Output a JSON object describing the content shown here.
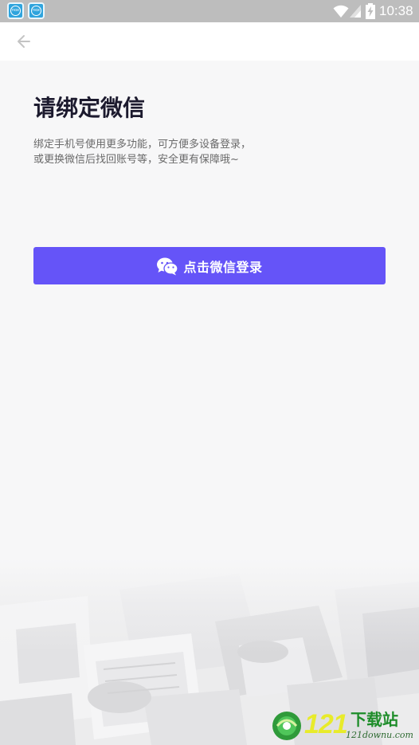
{
  "status_bar": {
    "time": "10:38",
    "notification_icons": [
      "nox-app-icon",
      "nox-app-icon"
    ],
    "notification_icon_text": "nox",
    "icons": [
      "wifi-icon",
      "signal-icon",
      "battery-charging-icon"
    ]
  },
  "app_bar": {
    "back_icon": "arrow-left-icon"
  },
  "main": {
    "title": "请绑定微信",
    "description_lines": [
      "绑定手机号使用更多功能，可方便多设备登录，",
      "或更换微信后找回账号等，安全更有保障哦~"
    ],
    "wechat_button": {
      "icon": "wechat-icon",
      "label": "点击微信登录"
    }
  },
  "watermark": {
    "number": "121",
    "text": "下载站",
    "url": "121downu.com"
  },
  "colors": {
    "status_bar": "#bdbdbd",
    "app_bar": "#ffffff",
    "page_background": "#f7f7f8",
    "title": "#1c1a2e",
    "description": "#6a6a6a",
    "button": "#6554f8",
    "button_text": "#ffffff"
  }
}
